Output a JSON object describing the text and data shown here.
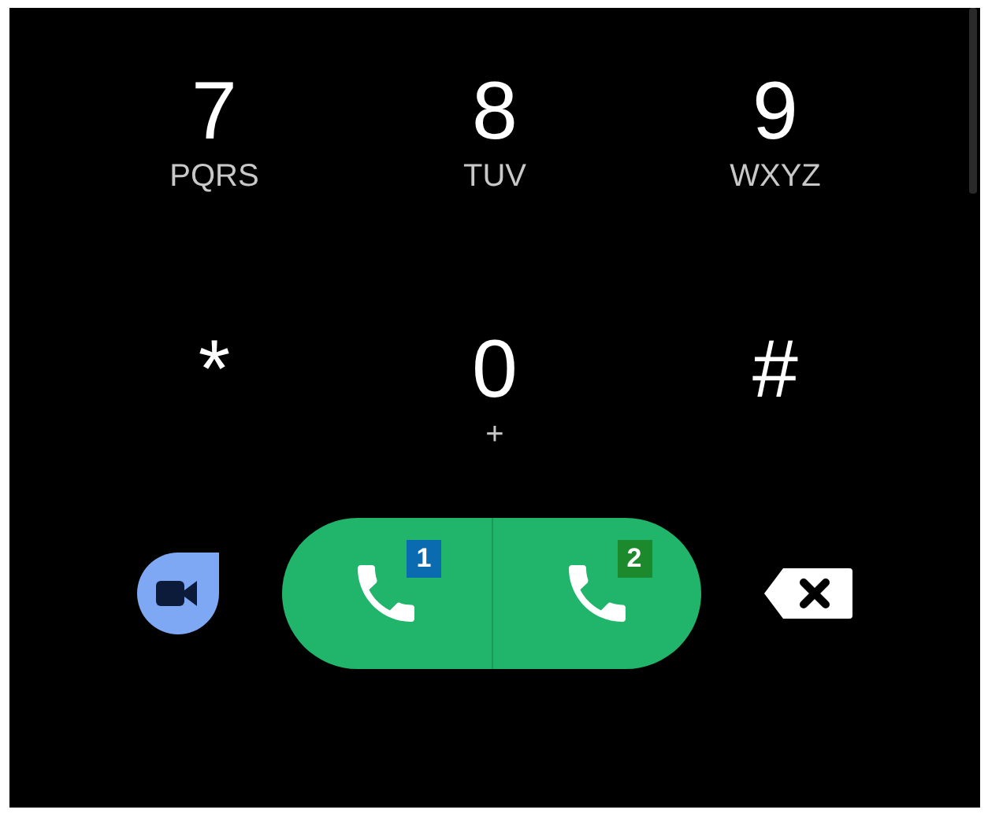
{
  "keys": [
    {
      "digit": "7",
      "letters": "PQRS"
    },
    {
      "digit": "8",
      "letters": "TUV"
    },
    {
      "digit": "9",
      "letters": "WXYZ"
    },
    {
      "digit": "*"
    },
    {
      "digit": "0",
      "letters": "+"
    },
    {
      "digit": "#"
    }
  ],
  "call_buttons": [
    {
      "sim": "1",
      "color": "#0a6bb0"
    },
    {
      "sim": "2",
      "color": "#1c8a2c"
    }
  ]
}
